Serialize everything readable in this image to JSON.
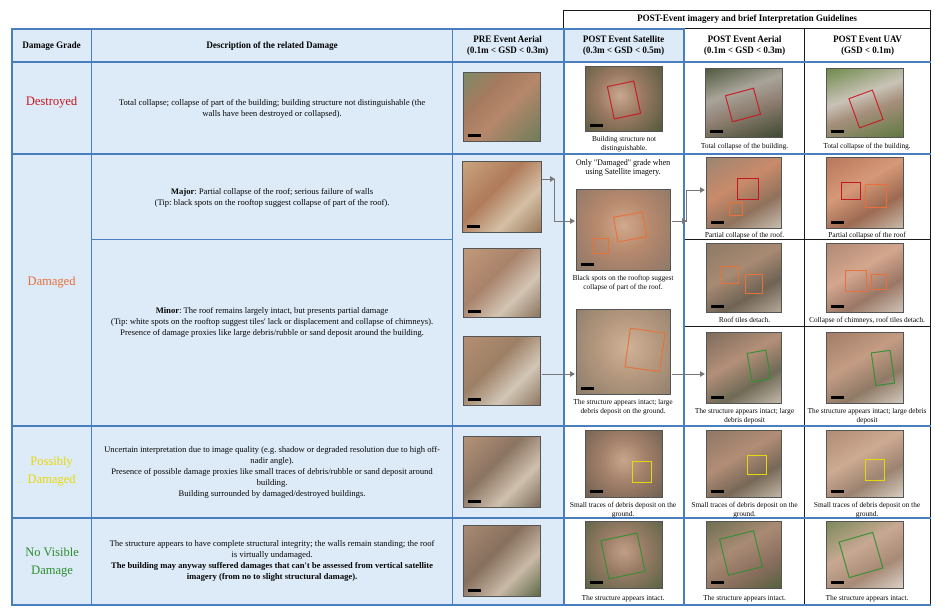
{
  "header": {
    "top_banner": "POST-Event imagery and brief Interpretation Guidelines",
    "col_grade": "Damage Grade",
    "col_desc": "Description of the related Damage",
    "col_pre_title": "PRE Event Aerial",
    "col_pre_gsd": "(0.1m < GSD < 0.3m)",
    "col_sat_title": "POST Event Satellite",
    "col_sat_gsd": "(0.3m < GSD < 0.5m)",
    "col_aer_title": "POST Event Aerial",
    "col_aer_gsd": "(0.1m < GSD < 0.3m)",
    "col_uav_title": "POST Event UAV",
    "col_uav_gsd": "(GSD < 0.1m)"
  },
  "colors": {
    "destroyed": "#c8161d",
    "damaged": "#e8703a",
    "possibly": "#e6d80b",
    "novisible": "#2e8f2e",
    "header_bg": "#ddeaf7",
    "border_blue": "#4a7fbf"
  },
  "rows": {
    "destroyed": {
      "grade": "Destroyed",
      "desc": "Total collapse; collapse of part of the building; building structure not distinguishable (the walls have been destroyed or collapsed).",
      "sat_caption": "Building structure not distinguishable.",
      "aer_caption": "Total collapse of the building.",
      "uav_caption": "Total collapse of the building."
    },
    "damaged": {
      "grade": "Damaged",
      "major_label": "Major",
      "major_text": ": Partial collapse of the roof; serious failure of walls",
      "major_tip": "(Tip: black spots on the rooftop suggest collapse of part of the roof).",
      "minor_label": "Minor",
      "minor_text": ": The roof remains largely intact, but presents partial damage",
      "minor_tip": "(Tip: white spots on the rooftop suggest tiles' lack or displacement and collapse of chimneys).",
      "minor_proxies": "Presence of damage proxies like large debris/rubble or sand deposit around the building.",
      "sat_note": "Only \"Damaged\" grade when using Satellite imagery.",
      "sat_caption_major": "Black spots on the rooftop suggest collapse of part of the roof.",
      "sat_caption_minor": "The structure appears intact; large debris deposit on the ground.",
      "aer_caption_major": "Partial collapse of the roof.",
      "uav_caption_major": "Partial collapse of the roof",
      "aer_caption_minor1": "Roof tiles detach.",
      "uav_caption_minor1": "Collapse of chimneys, roof tiles detach.",
      "aer_caption_minor2": "The structure appears intact; large debris deposit",
      "uav_caption_minor2": "The structure appears intact; large debris deposit"
    },
    "possibly": {
      "grade": "Possibly Damaged",
      "desc1": "Uncertain interpretation due to image quality (e.g. shadow or degraded resolution due to high off-nadir angle).",
      "desc2": "Presence of possible damage proxies like small traces of debris/rubble or sand deposit around building.",
      "desc3": "Building surrounded by damaged/destroyed buildings.",
      "sat_caption": "Small traces of debris deposit on the ground.",
      "aer_caption": "Small traces of debris deposit on the ground.",
      "uav_caption": "Small traces of debris deposit on the ground."
    },
    "novisible": {
      "grade": "No Visible Damage",
      "desc1": "The structure appears to have complete structural integrity; the walls remain standing; the roof is virtually undamaged.",
      "desc2": "The building may anyway suffered damages that can't be assessed from vertical satellite imagery (from no to slight structural damage).",
      "sat_caption": "The structure appears intact.",
      "aer_caption": "The structure appears intact.",
      "uav_caption": "The structure appears intact."
    }
  }
}
